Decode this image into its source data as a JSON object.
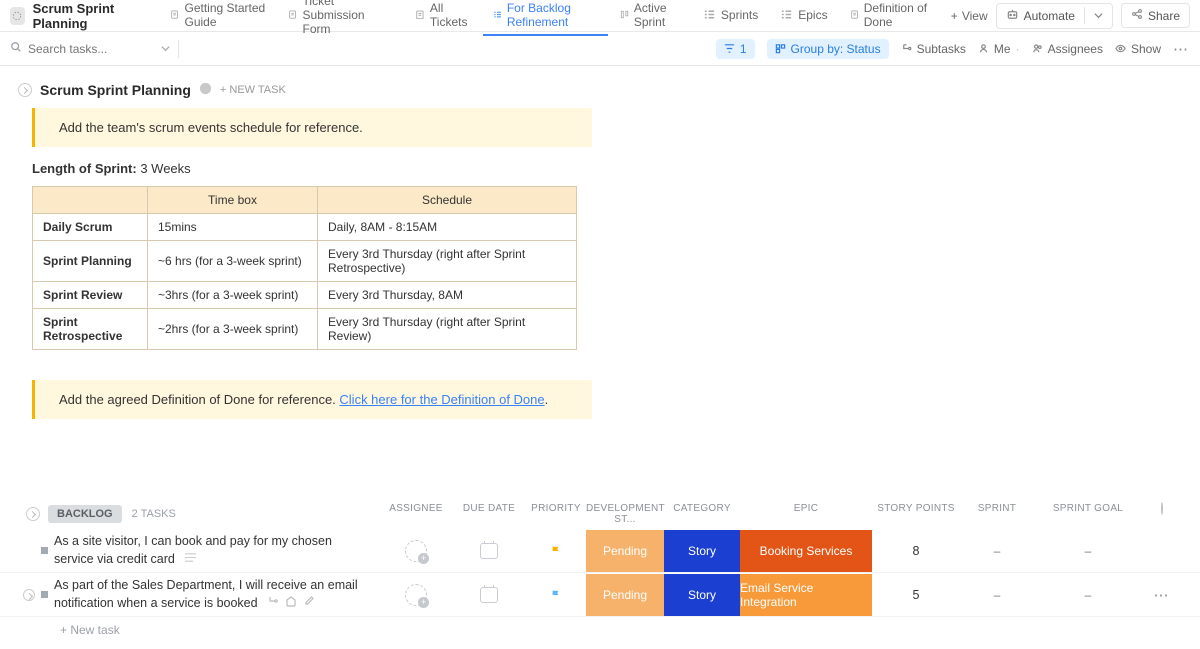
{
  "header": {
    "title": "Scrum Sprint Planning",
    "tabs": [
      {
        "label": "Getting Started Guide"
      },
      {
        "label": "Ticket Submission Form"
      },
      {
        "label": "All Tickets"
      },
      {
        "label": "For Backlog Refinement"
      },
      {
        "label": "Active Sprint"
      },
      {
        "label": "Sprints"
      },
      {
        "label": "Epics"
      },
      {
        "label": "Definition of Done"
      }
    ],
    "view_btn": "View",
    "automate": "Automate",
    "share": "Share"
  },
  "toolbar": {
    "search_placeholder": "Search tasks...",
    "filter_count": "1",
    "group_by": "Group by: Status",
    "subtasks": "Subtasks",
    "me": "Me",
    "assignees": "Assignees",
    "show": "Show"
  },
  "list": {
    "title": "Scrum Sprint Planning",
    "new_task": "+ NEW TASK",
    "notice1": "Add the team's scrum events schedule for reference.",
    "sprint_len_label": "Length of Sprint:",
    "sprint_len_value": " 3 Weeks",
    "table_headers": [
      "",
      "Time box",
      "Schedule"
    ],
    "table_rows": [
      [
        "Daily Scrum",
        "15mins",
        "Daily, 8AM - 8:15AM"
      ],
      [
        "Sprint Planning",
        "~6 hrs (for a 3-week sprint)",
        "Every 3rd Thursday (right after Sprint Retrospective)"
      ],
      [
        "Sprint Review",
        "~3hrs (for a 3-week sprint)",
        "Every 3rd Thursday, 8AM"
      ],
      [
        "Sprint Retrospective",
        "~2hrs (for a 3-week sprint)",
        "Every 3rd Thursday (right after Sprint Review)"
      ]
    ],
    "notice2_pre": "Add the agreed Definition of Done for reference. ",
    "notice2_link": "Click here for the Definition of Done",
    "notice2_post": "."
  },
  "backlog": {
    "group_label": "BACKLOG",
    "task_count": "2 TASKS",
    "columns": [
      "ASSIGNEE",
      "DUE DATE",
      "PRIORITY",
      "DEVELOPMENT ST...",
      "CATEGORY",
      "EPIC",
      "STORY POINTS",
      "SPRINT",
      "SPRINT GOAL"
    ],
    "rows": [
      {
        "title": "As a site visitor, I can book and pay for my chosen service via credit card",
        "priority_color": "#f4b400",
        "dev": "Pending",
        "cat": "Story",
        "epic": "Booking Services",
        "epic_class": "epic1",
        "sp": "8",
        "sprint": "–",
        "goal": "–",
        "show_icons": false,
        "show_more": false
      },
      {
        "title": "As part of the Sales Department, I will receive an email notification when a service is booked",
        "priority_color": "#62b6f7",
        "dev": "Pending",
        "cat": "Story",
        "epic": "Email Service Integration",
        "epic_class": "epic2",
        "sp": "5",
        "sprint": "–",
        "goal": "–",
        "show_icons": true,
        "show_more": true
      }
    ],
    "new_task": "+ New task"
  }
}
